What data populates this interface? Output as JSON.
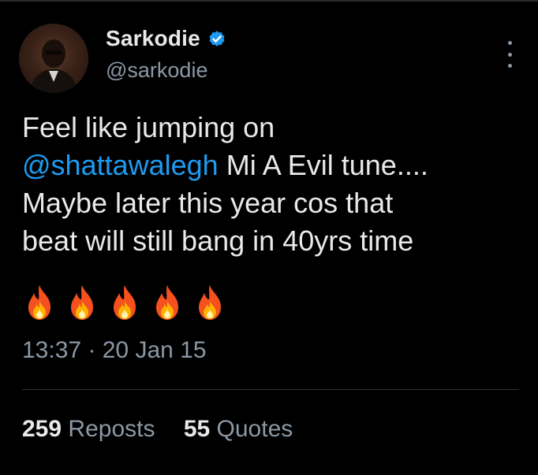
{
  "tweet": {
    "author": {
      "display_name": "Sarkodie",
      "handle": "@sarkodie",
      "verified": true,
      "verified_color": "#1d9bf0"
    },
    "text_lines": [
      "Feel like jumping on",
      "Mi A Evil tune....",
      "Maybe later this year cos that",
      "beat will still bang in 40yrs time"
    ],
    "mention": "@shattawalegh",
    "mention_color": "#1d9bf0",
    "emoji": [
      "🔥",
      "🔥",
      "🔥",
      "🔥",
      "🔥"
    ],
    "timestamp": "13:37 · 20 Jan 15",
    "stats": {
      "reposts_count": "259",
      "reposts_label": "Reposts",
      "quotes_count": "55",
      "quotes_label": "Quotes"
    }
  },
  "icons": {
    "verified": "verified-badge-icon",
    "more": "more-options-icon",
    "fire": "fire-emoji-icon"
  }
}
